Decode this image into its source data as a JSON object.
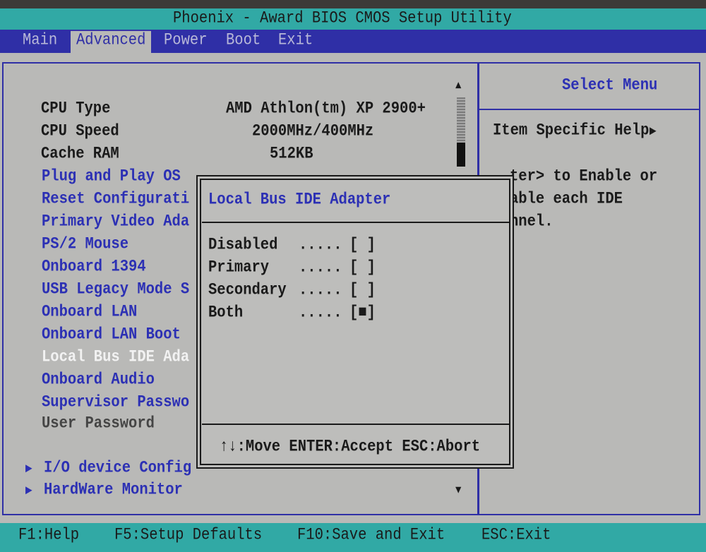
{
  "title": "Phoenix - Award BIOS CMOS Setup Utility",
  "menu": [
    {
      "label": "Main",
      "active": false
    },
    {
      "label": "Advanced",
      "active": true
    },
    {
      "label": "Power",
      "active": false
    },
    {
      "label": "Boot",
      "active": false
    },
    {
      "label": "Exit",
      "active": false
    }
  ],
  "info": [
    {
      "label": "CPU Type",
      "value": "AMD Athlon(tm) XP 2900+"
    },
    {
      "label": "CPU Speed",
      "value": "2000MHz/400MHz"
    },
    {
      "label": "Cache RAM",
      "value": "512KB"
    }
  ],
  "items": [
    "Plug and Play OS",
    "Reset Configurati",
    "Primary Video Ada",
    "PS/2 Mouse",
    "Onboard 1394",
    "USB Legacy Mode S",
    "Onboard LAN",
    "Onboard LAN Boot",
    "Local Bus IDE Ada",
    "Onboard Audio",
    "Supervisor Passwo",
    "User Password"
  ],
  "selected_item": "Local Bus IDE Ada",
  "submenus": [
    "I/O device Config",
    "HardWare Monitor"
  ],
  "help": {
    "header": "Select Menu",
    "subheader": "Item Specific Help",
    "lines": [
      "ter> to Enable or",
      "able each IDE",
      "nnel."
    ]
  },
  "popup": {
    "title": "Local Bus IDE Adapter",
    "options": [
      {
        "label": "Disabled",
        "dots": ".....",
        "mark": "[ ]",
        "selected": false
      },
      {
        "label": "Primary",
        "dots": ".....",
        "mark": "[ ]",
        "selected": false
      },
      {
        "label": "Secondary",
        "dots": ".....",
        "mark": "[ ]",
        "selected": false
      },
      {
        "label": "Both",
        "dots": ".....",
        "mark": "[■]",
        "selected": true
      }
    ],
    "footer": "↑↓:Move ENTER:Accept ESC:Abort"
  },
  "bottom": [
    "F1:Help",
    "F5:Setup Defaults",
    "F10:Save and Exit",
    "ESC:Exit"
  ],
  "colors": {
    "title_bar": "#31a9a5",
    "menu_bar": "#2f2fa6",
    "background": "#b9b9b7",
    "item_text": "#2c30b4",
    "selected_text": "#f2f2f2"
  }
}
